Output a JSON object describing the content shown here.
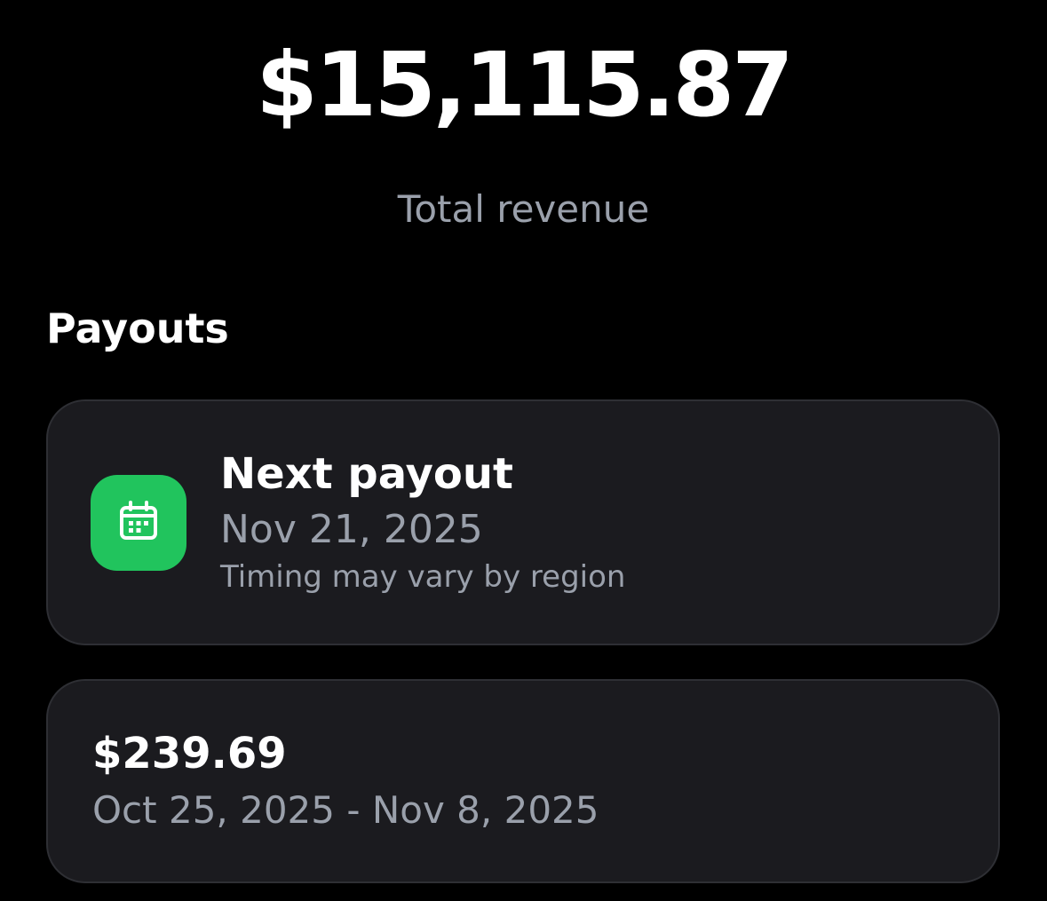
{
  "revenue": {
    "amount": "$15,115.87",
    "label": "Total revenue"
  },
  "payouts": {
    "title": "Payouts",
    "next": {
      "icon": "calendar-icon",
      "icon_color": "#21c45d",
      "title": "Next payout",
      "date": "Nov 21, 2025",
      "note": "Timing may vary by region"
    },
    "history": [
      {
        "amount": "$239.69",
        "range": "Oct 25, 2025 - Nov 8, 2025"
      }
    ]
  }
}
